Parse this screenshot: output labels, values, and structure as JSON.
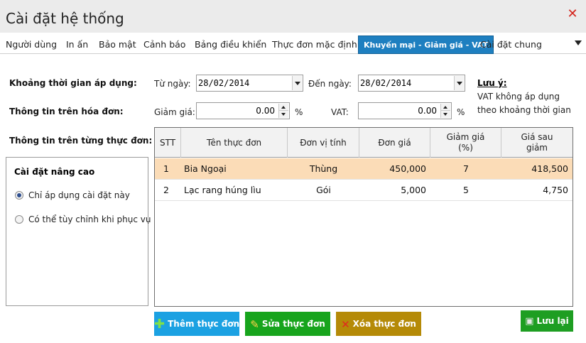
{
  "window": {
    "title": "Cài đặt hệ thống",
    "close_icon": "close-icon"
  },
  "tabs": [
    {
      "label": "Người dùng",
      "active": false
    },
    {
      "label": "In ấn",
      "active": false
    },
    {
      "label": "Bảo mật",
      "active": false
    },
    {
      "label": "Cảnh báo",
      "active": false
    },
    {
      "label": "Bảng điều khiển",
      "active": false
    },
    {
      "label": "Thực đơn mặc định",
      "active": false
    },
    {
      "label": "Khuyến mại - Giảm giá - VAT",
      "active": true
    },
    {
      "label": "Cài đặt chung",
      "active": false
    }
  ],
  "form": {
    "period_label": "Khoảng thời gian áp dụng:",
    "from_label": "Từ ngày:",
    "from_value": "28/02/2014",
    "to_label": "Đến ngày:",
    "to_value": "28/02/2014",
    "invoice_label": "Thông tin trên hóa đơn:",
    "discount_label": "Giảm giá:",
    "discount_value": "0.00",
    "discount_unit": "%",
    "vat_label": "VAT:",
    "vat_value": "0.00",
    "vat_unit": "%",
    "per_menu_label": "Thông tin trên từng thực đơn:"
  },
  "note": {
    "title": "Lưu ý:",
    "line1": "VAT không áp dụng",
    "line2": "theo khoảng thời gian"
  },
  "advanced": {
    "title": "Cài đặt nâng cao",
    "options": [
      {
        "label": "Chỉ áp dụng cài đặt này",
        "selected": true
      },
      {
        "label": "Có thể tùy chỉnh khi phục vụ",
        "selected": false
      }
    ]
  },
  "table": {
    "headers": [
      "STT",
      "Tên thực đơn",
      "Đơn vị tính",
      "Đơn giá",
      "Giảm giá (%)",
      "Giá sau giảm"
    ],
    "rows": [
      {
        "stt": "1",
        "name": "Bia Ngoại",
        "unit": "Thùng",
        "price": "450,000",
        "discount": "7",
        "final": "418,500",
        "selected": true
      },
      {
        "stt": "2",
        "name": "Lạc rang húng lìu",
        "unit": "Gói",
        "price": "5,000",
        "discount": "5",
        "final": "4,750",
        "selected": false
      }
    ]
  },
  "buttons": {
    "add": "Thêm thực đơn",
    "edit": "Sửa thực đơn",
    "delete": "Xóa thực đơn",
    "save": "Lưu lại"
  },
  "colors": {
    "active_tab": "#1e7fc0",
    "selected_row": "#fbdcb7",
    "add_button": "#1ba1e2",
    "edit_button": "#17a41c",
    "delete_button": "#b58a07",
    "save_button": "#1e9e22",
    "close_icon": "#d4241c"
  }
}
